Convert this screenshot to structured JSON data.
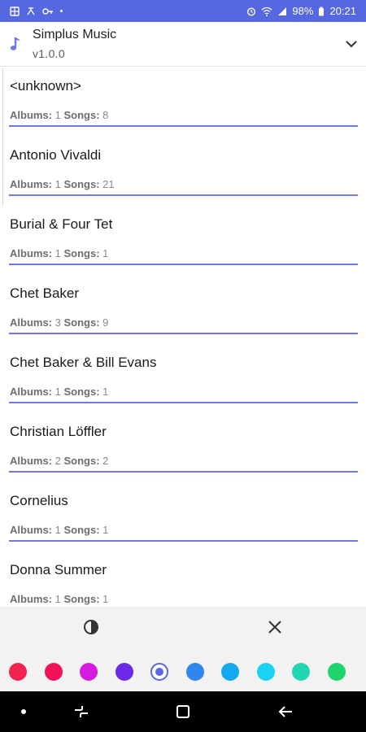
{
  "status_bar": {
    "battery": "98%",
    "time": "20:21",
    "left_icons": [
      "gallery-icon",
      "cast-icon",
      "key-icon",
      "dot-icon"
    ],
    "right_icons": [
      "alarm-icon",
      "wifi-icon",
      "signal-icon",
      "battery-icon"
    ]
  },
  "app": {
    "name": "Simplus Music",
    "version": "v1.0.0",
    "icon": "music-note-icon",
    "dropdown_icon": "chevron-down-icon"
  },
  "artists": [
    {
      "name": "<unknown>",
      "albums_label": "Albums:",
      "albums": "1",
      "songs_label": "Songs:",
      "songs": "8"
    },
    {
      "name": "Antonio Vivaldi",
      "albums_label": "Albums:",
      "albums": "1",
      "songs_label": "Songs:",
      "songs": "21"
    },
    {
      "name": "Burial & Four Tet",
      "albums_label": "Albums:",
      "albums": "1",
      "songs_label": "Songs:",
      "songs": "1"
    },
    {
      "name": "Chet Baker",
      "albums_label": "Albums:",
      "albums": "3",
      "songs_label": "Songs:",
      "songs": "9"
    },
    {
      "name": "Chet Baker & Bill Evans",
      "albums_label": "Albums:",
      "albums": "1",
      "songs_label": "Songs:",
      "songs": "1"
    },
    {
      "name": "Christian Löffler",
      "albums_label": "Albums:",
      "albums": "2",
      "songs_label": "Songs:",
      "songs": "2"
    },
    {
      "name": "Cornelius",
      "albums_label": "Albums:",
      "albums": "1",
      "songs_label": "Songs:",
      "songs": "1"
    },
    {
      "name": "Donna Summer",
      "albums_label": "Albums:",
      "albums": "1",
      "songs_label": "Songs:",
      "songs": "1"
    }
  ],
  "panel": {
    "theme_icon": "contrast-icon",
    "close_icon": "close-icon",
    "accent": "#5b67e8",
    "swatches": [
      {
        "color": "#f0244e",
        "selected": false
      },
      {
        "color": "#f01357",
        "selected": false
      },
      {
        "color": "#d61be0",
        "selected": false
      },
      {
        "color": "#6d27e6",
        "selected": false
      },
      {
        "color": "#5b67e8",
        "selected": true
      },
      {
        "color": "#2f86ee",
        "selected": false
      },
      {
        "color": "#14a8f2",
        "selected": false
      },
      {
        "color": "#1cd2f2",
        "selected": false
      },
      {
        "color": "#21d6b0",
        "selected": false
      },
      {
        "color": "#1dd46d",
        "selected": false
      }
    ]
  },
  "nav_bar": {
    "items": [
      "dot-icon",
      "recent-apps-icon",
      "home-icon",
      "back-icon"
    ]
  }
}
